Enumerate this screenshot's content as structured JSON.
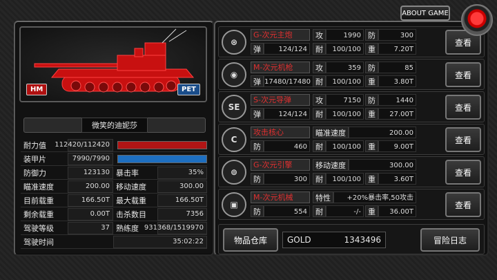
{
  "top": {
    "about_label": "ABOUT GAME"
  },
  "tank": {
    "hm_label": "HM",
    "pet_label": "PET",
    "name": "微笑的迪妮莎"
  },
  "stats": {
    "hp_label": "耐力值",
    "hp_value": "112420/112420",
    "hp_fraction": 1.0,
    "armor_label": "装甲片",
    "armor_value": "7990/7990",
    "armor_fraction": 1.0,
    "rows": [
      {
        "l1": "防御力",
        "v1": "123130",
        "l2": "暴击率",
        "v2": "35%"
      },
      {
        "l1": "瞄准速度",
        "v1": "200.00",
        "l2": "移动速度",
        "v2": "300.00"
      },
      {
        "l1": "目前载重",
        "v1": "166.50T",
        "l2": "最大载重",
        "v2": "166.50T"
      },
      {
        "l1": "剩余载重",
        "v1": "0.00T",
        "l2": "击杀数目",
        "v2": "7356"
      },
      {
        "l1": "驾驶等级",
        "v1": "37",
        "l2": "熟练度",
        "v2": "931368/1519970"
      }
    ],
    "time_label": "驾驶时间",
    "time_value": "35:02:22"
  },
  "weapons": [
    {
      "icon": "⊛",
      "name": "G-次元主炮",
      "a1k": "攻",
      "a1v": "1990",
      "a2k": "防",
      "a2v": "300",
      "b1k": "弹",
      "b1v": "124/124",
      "b2k": "耐",
      "b2v": "100/100",
      "b3k": "重",
      "b3v": "7.20T",
      "btn": "查看"
    },
    {
      "icon": "◉",
      "name": "M-次元机枪",
      "a1k": "攻",
      "a1v": "359",
      "a2k": "防",
      "a2v": "85",
      "b1k": "弹",
      "b1v": "17480/17480",
      "b2k": "耐",
      "b2v": "100/100",
      "b3k": "重",
      "b3v": "3.80T",
      "btn": "查看"
    },
    {
      "icon": "SE",
      "name": "S-次元导弹",
      "a1k": "攻",
      "a1v": "7150",
      "a2k": "防",
      "a2v": "1440",
      "b1k": "弹",
      "b1v": "124/124",
      "b2k": "耐",
      "b2v": "100/100",
      "b3k": "重",
      "b3v": "27.00T",
      "btn": "查看"
    },
    {
      "icon": "C",
      "name": "攻击核心",
      "a1k": "瞄准速度",
      "a1v": "200.00",
      "a2k": "",
      "a2v": "",
      "b1k": "防",
      "b1v": "460",
      "b2k": "耐",
      "b2v": "100/100",
      "b3k": "重",
      "b3v": "9.00T",
      "btn": "查看"
    },
    {
      "icon": "⊚",
      "name": "G-次元引擎",
      "a1k": "移动速度",
      "a1v": "300.00",
      "a2k": "",
      "a2v": "",
      "b1k": "防",
      "b1v": "300",
      "b2k": "耐",
      "b2v": "100/100",
      "b3k": "重",
      "b3v": "3.60T",
      "btn": "查看"
    },
    {
      "icon": "▣",
      "name": "M-次元机械",
      "a1k": "特性",
      "a1v": "+20%暴击率,50攻击",
      "a2k": "",
      "a2v": "",
      "b1k": "防",
      "b1v": "554",
      "b2k": "耐",
      "b2v": "-/-",
      "b3k": "重",
      "b3v": "36.00T",
      "btn": "查看"
    }
  ],
  "bottom": {
    "warehouse": "物品仓库",
    "gold_label": "GOLD",
    "gold_value": "1343496",
    "log": "冒险日志"
  },
  "colors": {
    "hp_bar": "#b01515",
    "armor_bar": "#1e6fc0",
    "weapon_name": "#e03030"
  }
}
